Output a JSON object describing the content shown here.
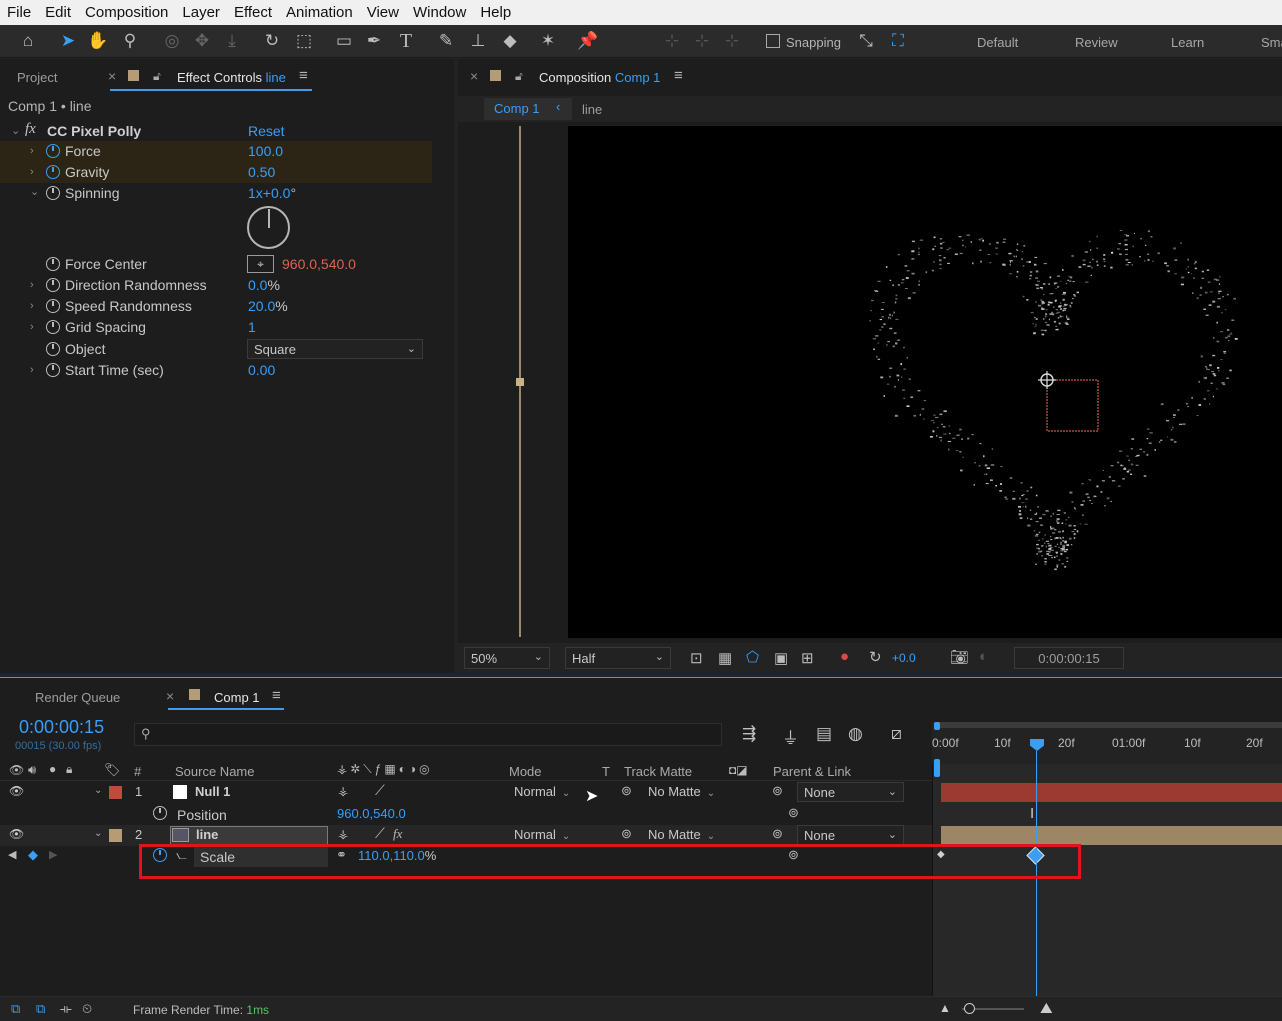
{
  "menu": [
    "File",
    "Edit",
    "Composition",
    "Layer",
    "Effect",
    "Animation",
    "View",
    "Window",
    "Help"
  ],
  "toolbar": {
    "snapping": "Snapping",
    "workspaces": [
      "Default",
      "Review",
      "Learn",
      "Sma"
    ]
  },
  "left_panel": {
    "tab_project": "Project",
    "tab_effect_prefix": "Effect Controls",
    "tab_effect_layer": "line",
    "breadcrumb": "Comp 1 • line",
    "effect_name": "CC Pixel Polly",
    "reset": "Reset",
    "props": [
      {
        "name": "Force",
        "value": "100.0",
        "suffix": ""
      },
      {
        "name": "Gravity",
        "value": "0.50",
        "suffix": ""
      },
      {
        "name": "Spinning",
        "value": "1x+0.0",
        "suffix": "°"
      },
      {
        "name": "Force Center",
        "value": "960.0,540.0",
        "suffix": ""
      },
      {
        "name": "Direction Randomness",
        "value": "0.0",
        "suffix": "%"
      },
      {
        "name": "Speed Randomness",
        "value": "20.0",
        "suffix": "%"
      },
      {
        "name": "Grid Spacing",
        "value": "1",
        "suffix": ""
      },
      {
        "name": "Object",
        "value": "Square",
        "suffix": ""
      },
      {
        "name": "Start Time (sec)",
        "value": "0.00",
        "suffix": ""
      }
    ]
  },
  "comp_panel": {
    "tab_prefix": "Composition",
    "tab_comp": "Comp 1",
    "crumb_comp": "Comp 1",
    "crumb_layer": "line",
    "zoom": "50%",
    "resolution": "Half",
    "exposure": "+0.0",
    "timecode": "0:00:00:15"
  },
  "timeline": {
    "tab_render": "Render Queue",
    "tab_comp": "Comp 1",
    "timecode": "0:00:00:15",
    "frame_info": "00015 (30.00 fps)",
    "headers": {
      "num": "#",
      "source": "Source Name",
      "mode": "Mode",
      "t": "T",
      "matte": "Track Matte",
      "parent": "Parent & Link"
    },
    "ruler": [
      "0:00f",
      "10f",
      "20f",
      "01:00f",
      "10f",
      "20f"
    ],
    "layers": [
      {
        "num": "1",
        "name": "Null 1",
        "mode": "Normal",
        "matte": "No Matte",
        "parent": "None",
        "color": "#c04a3b"
      },
      {
        "num": "2",
        "name": "line",
        "mode": "Normal",
        "matte": "No Matte",
        "parent": "None",
        "color": "#b59b76"
      }
    ],
    "position": {
      "label": "Position",
      "value": "960.0,540.0"
    },
    "scale": {
      "label": "Scale",
      "value": "110.0,110.0",
      "suffix": "%"
    },
    "status_label": "Frame Render Time:",
    "status_value": "1ms"
  },
  "colors": {
    "accent": "#3a9ef5",
    "highlight_box": "#e0141a"
  }
}
